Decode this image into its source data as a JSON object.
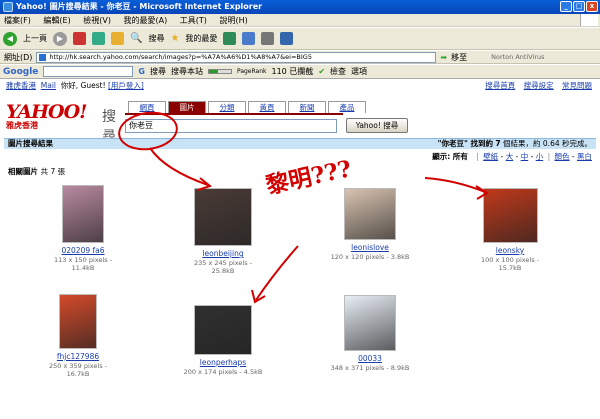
{
  "window": {
    "title": "Yahoo! 圖片搜尋結果 - 你老豆 - Microsoft Internet Explorer",
    "min": "_",
    "max": "□",
    "close": "x"
  },
  "menu": [
    "檔案(F)",
    "編輯(E)",
    "檢視(V)",
    "我的最愛(A)",
    "工具(T)",
    "說明(H)"
  ],
  "toolbar": {
    "back": "上一頁",
    "search": "搜尋",
    "favorites": "我的最愛"
  },
  "address": {
    "label": "網址(D)",
    "url": "http://hk.search.yahoo.com/search/images?p=%A7A%A6%D1%A8%A7&ei=BIG5",
    "go": "移至",
    "extra": "Norton AntiVirus"
  },
  "google": {
    "logo": "Google",
    "search": "搜尋",
    "site": "搜尋本站",
    "pagerank": "PageRank",
    "blocked": "110 已攔截",
    "check": "檢查",
    "options": "選項"
  },
  "yahoo": {
    "left_links": [
      "雅虎香港",
      "Mail"
    ],
    "greeting": "你好, Guest!",
    "signin": "[用戶登入]",
    "right_links": [
      "搜尋首頁",
      "搜尋設定",
      "常見問題"
    ],
    "logo_text": "YAHOO!",
    "logo_sub": "雅虎香港",
    "logo_search": "搜尋",
    "tabs": [
      "網頁",
      "圖片",
      "分類",
      "黃頁",
      "新聞",
      "產品"
    ],
    "active_tab": 1,
    "query": "你老豆",
    "search_button": "Yahoo! 搜尋",
    "results_label": "圖片搜尋結果",
    "results_summary_pre": "\"你老豆\" 找到約",
    "results_count": "7",
    "results_summary_post": "個結果，約 0.64 秒完成。",
    "show_label": "顯示: 所有",
    "show_options": [
      "壁紙",
      "大",
      "中",
      "小",
      "顏色",
      "黑白"
    ],
    "related_label": "相關圖片",
    "related_count": "共 7 張"
  },
  "images": [
    {
      "name": "020209 fa6",
      "meta": "113 x 150 pixels - 11.4kB",
      "color": "#b98aa0"
    },
    {
      "name": "leonbeijing",
      "meta": "235 x 245 pixels - 25.8kB",
      "color": "#4a3b36"
    },
    {
      "name": "leonislove",
      "meta": "120 x 120 pixels - 3.8kB",
      "color": "#d9c3b0"
    },
    {
      "name": "leonsky",
      "meta": "100 x 100 pixels - 15.7kB",
      "color": "#c0391b"
    },
    {
      "name": "fhjc127986",
      "meta": "250 x 359 pixels - 16.7kB",
      "color": "#d44a2a"
    },
    {
      "name": "leonperhaps",
      "meta": "200 x 174 pixels - 4.5kB",
      "color": "#303030"
    },
    {
      "name": "00033",
      "meta": "348 x 371 pixels - 8.9kB",
      "color": "#e8eef5"
    }
  ],
  "annotation": {
    "text": "黎明???",
    "color": "#d30000"
  }
}
